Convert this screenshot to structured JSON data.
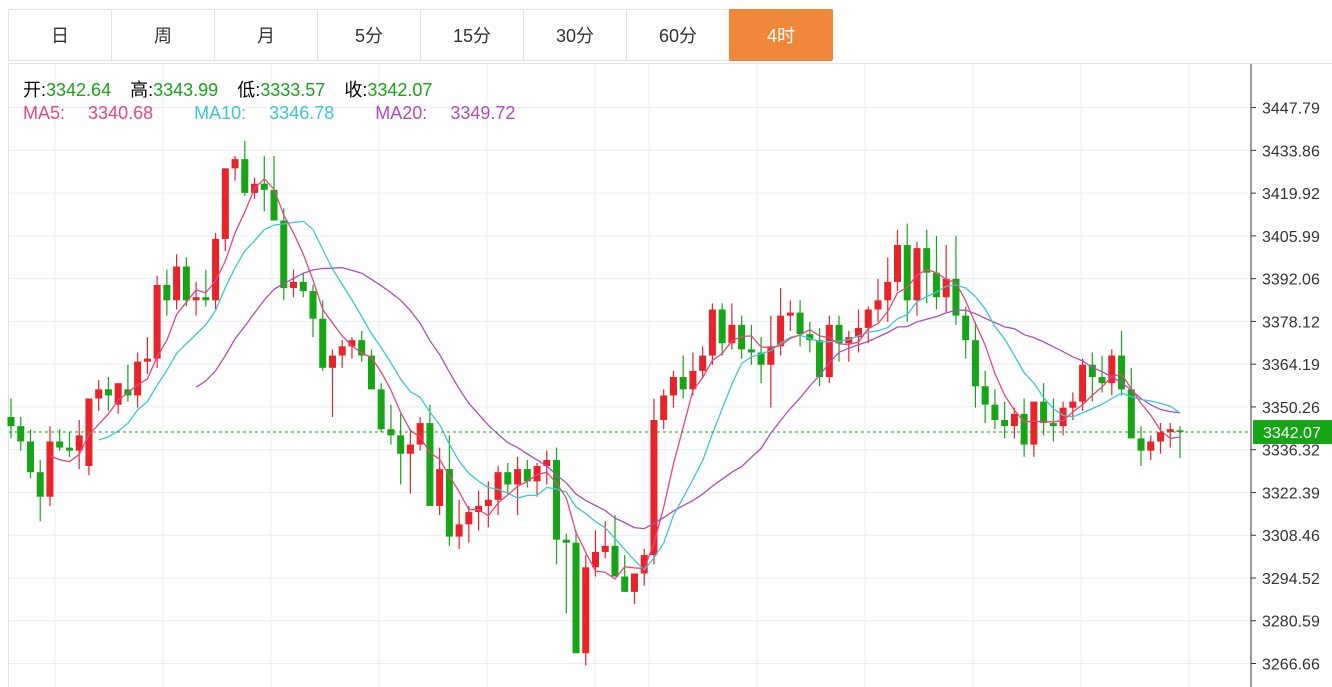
{
  "tabs": [
    {
      "label": "日",
      "active": false
    },
    {
      "label": "周",
      "active": false
    },
    {
      "label": "月",
      "active": false
    },
    {
      "label": "5分",
      "active": false
    },
    {
      "label": "15分",
      "active": false
    },
    {
      "label": "30分",
      "active": false
    },
    {
      "label": "60分",
      "active": false
    },
    {
      "label": "4时",
      "active": true
    }
  ],
  "ohlc": {
    "open_label": "开:",
    "open": "3342.64",
    "high_label": "高:",
    "high": "3343.99",
    "low_label": "低:",
    "low": "3333.57",
    "close_label": "收:",
    "close": "3342.07"
  },
  "ma": {
    "ma5_label": "MA5:",
    "ma5": "3340.68",
    "ma10_label": "MA10:",
    "ma10": "3346.78",
    "ma20_label": "MA20:",
    "ma20": "3349.72"
  },
  "colors": {
    "up": "#e8232a",
    "down": "#16a516",
    "ma5": "#e8477a",
    "ma10": "#3cc8d4",
    "ma20": "#b24bbd",
    "grid": "#e8eef3",
    "active_tab": "#f0883a",
    "current_price": "#16a516"
  },
  "chart_data": {
    "type": "candlestick",
    "ylim": [
      3259,
      3462
    ],
    "y_ticks": [
      "3447.79",
      "3433.86",
      "3419.92",
      "3405.99",
      "3392.06",
      "3378.12",
      "3364.19",
      "3350.26",
      "3336.32",
      "3322.39",
      "3308.46",
      "3294.52",
      "3280.59",
      "3266.66"
    ],
    "current_price": "3342.07",
    "candles": [
      [
        3347,
        3353,
        3340,
        3344
      ],
      [
        3344,
        3347,
        3336,
        3339
      ],
      [
        3339,
        3343,
        3327,
        3329
      ],
      [
        3329,
        3333,
        3313,
        3321
      ],
      [
        3321,
        3344,
        3318,
        3339
      ],
      [
        3339,
        3343,
        3336,
        3337
      ],
      [
        3337,
        3342,
        3334,
        3336
      ],
      [
        3336,
        3346,
        3330,
        3341
      ],
      [
        3331,
        3347,
        3328,
        3353
      ],
      [
        3353,
        3359,
        3349,
        3356
      ],
      [
        3356,
        3360,
        3349,
        3354
      ],
      [
        3351,
        3356,
        3348,
        3358
      ],
      [
        3356,
        3364,
        3352,
        3354
      ],
      [
        3354,
        3368,
        3350,
        3365
      ],
      [
        3365,
        3373,
        3361,
        3366
      ],
      [
        3366,
        3393,
        3363,
        3390
      ],
      [
        3390,
        3395,
        3380,
        3385
      ],
      [
        3385,
        3400,
        3382,
        3396
      ],
      [
        3396,
        3399,
        3383,
        3385
      ],
      [
        3385,
        3391,
        3380,
        3386
      ],
      [
        3386,
        3395,
        3383,
        3385
      ],
      [
        3385,
        3407,
        3382,
        3405
      ],
      [
        3405,
        3428,
        3401,
        3428
      ],
      [
        3428,
        3432,
        3424,
        3431
      ],
      [
        3431,
        3437,
        3419,
        3420
      ],
      [
        3420,
        3425,
        3418,
        3423
      ],
      [
        3423,
        3432,
        3414,
        3421
      ],
      [
        3421,
        3432,
        3417,
        3411
      ],
      [
        3411,
        3415,
        3385,
        3389
      ],
      [
        3389,
        3395,
        3386,
        3391
      ],
      [
        3391,
        3394,
        3386,
        3388
      ],
      [
        3388,
        3390,
        3373,
        3379
      ],
      [
        3379,
        3385,
        3362,
        3363
      ],
      [
        3363,
        3369,
        3347,
        3367
      ],
      [
        3367,
        3372,
        3363,
        3370
      ],
      [
        3370,
        3373,
        3366,
        3372
      ],
      [
        3372,
        3375,
        3365,
        3367
      ],
      [
        3367,
        3369,
        3356,
        3356
      ],
      [
        3356,
        3358,
        3342,
        3343
      ],
      [
        3343,
        3351,
        3338,
        3341
      ],
      [
        3341,
        3348,
        3325,
        3335
      ],
      [
        3335,
        3343,
        3322,
        3338
      ],
      [
        3338,
        3347,
        3336,
        3345
      ],
      [
        3345,
        3351,
        3319,
        3318
      ],
      [
        3318,
        3337,
        3315,
        3330
      ],
      [
        3330,
        3341,
        3305,
        3308
      ],
      [
        3308,
        3320,
        3304,
        3312
      ],
      [
        3312,
        3318,
        3306,
        3316
      ],
      [
        3316,
        3323,
        3310,
        3318
      ],
      [
        3318,
        3326,
        3311,
        3320
      ],
      [
        3320,
        3331,
        3315,
        3329
      ],
      [
        3329,
        3332,
        3322,
        3325
      ],
      [
        3325,
        3334,
        3315,
        3330
      ],
      [
        3330,
        3333,
        3324,
        3326
      ],
      [
        3326,
        3332,
        3321,
        3331
      ],
      [
        3331,
        3336,
        3325,
        3333
      ],
      [
        3333,
        3337,
        3299,
        3307
      ],
      [
        3307,
        3309,
        3283,
        3306
      ],
      [
        3306,
        3310,
        3276,
        3270
      ],
      [
        3270,
        3302,
        3266,
        3298
      ],
      [
        3298,
        3310,
        3295,
        3303
      ],
      [
        3303,
        3313,
        3301,
        3305
      ],
      [
        3305,
        3315,
        3296,
        3295
      ],
      [
        3295,
        3302,
        3290,
        3290
      ],
      [
        3290,
        3296,
        3286,
        3296
      ],
      [
        3296,
        3304,
        3292,
        3302
      ],
      [
        3302,
        3353,
        3299,
        3346
      ],
      [
        3346,
        3356,
        3343,
        3354
      ],
      [
        3354,
        3362,
        3350,
        3360
      ],
      [
        3360,
        3367,
        3353,
        3356
      ],
      [
        3356,
        3368,
        3354,
        3362
      ],
      [
        3362,
        3370,
        3360,
        3367
      ],
      [
        3367,
        3384,
        3364,
        3382
      ],
      [
        3382,
        3384,
        3367,
        3371
      ],
      [
        3371,
        3384,
        3369,
        3377
      ],
      [
        3377,
        3380,
        3366,
        3369
      ],
      [
        3369,
        3377,
        3364,
        3368
      ],
      [
        3368,
        3373,
        3358,
        3364
      ],
      [
        3364,
        3380,
        3350,
        3370
      ],
      [
        3370,
        3389,
        3367,
        3380
      ],
      [
        3380,
        3385,
        3375,
        3381
      ],
      [
        3381,
        3385,
        3370,
        3374
      ],
      [
        3374,
        3378,
        3368,
        3372
      ],
      [
        3372,
        3376,
        3357,
        3360
      ],
      [
        3360,
        3380,
        3358,
        3377
      ],
      [
        3377,
        3380,
        3365,
        3371
      ],
      [
        3371,
        3375,
        3365,
        3373
      ],
      [
        3373,
        3382,
        3368,
        3376
      ],
      [
        3376,
        3383,
        3371,
        3382
      ],
      [
        3382,
        3392,
        3378,
        3385
      ],
      [
        3385,
        3399,
        3378,
        3391
      ],
      [
        3391,
        3408,
        3388,
        3403
      ],
      [
        3403,
        3410,
        3378,
        3385
      ],
      [
        3385,
        3404,
        3380,
        3402
      ],
      [
        3402,
        3408,
        3384,
        3394
      ],
      [
        3394,
        3406,
        3382,
        3386
      ],
      [
        3386,
        3403,
        3381,
        3392
      ],
      [
        3392,
        3406,
        3377,
        3380
      ],
      [
        3380,
        3383,
        3366,
        3372
      ],
      [
        3372,
        3378,
        3350,
        3357
      ],
      [
        3357,
        3362,
        3345,
        3351
      ],
      [
        3351,
        3356,
        3343,
        3346
      ],
      [
        3346,
        3352,
        3340,
        3344
      ],
      [
        3344,
        3350,
        3340,
        3348
      ],
      [
        3348,
        3353,
        3334,
        3338
      ],
      [
        3338,
        3348,
        3334,
        3352
      ],
      [
        3352,
        3358,
        3341,
        3345
      ],
      [
        3345,
        3353,
        3339,
        3344
      ],
      [
        3344,
        3352,
        3341,
        3350
      ],
      [
        3350,
        3355,
        3346,
        3352
      ],
      [
        3352,
        3366,
        3349,
        3364
      ],
      [
        3364,
        3368,
        3352,
        3360
      ],
      [
        3360,
        3367,
        3355,
        3358
      ],
      [
        3358,
        3369,
        3354,
        3367
      ],
      [
        3367,
        3375,
        3354,
        3356
      ],
      [
        3356,
        3363,
        3343,
        3340
      ],
      [
        3340,
        3344,
        3331,
        3336
      ],
      [
        3336,
        3341,
        3333,
        3339
      ],
      [
        3339,
        3345,
        3335,
        3342
      ],
      [
        3342,
        3345,
        3337,
        3343
      ],
      [
        3342.64,
        3343.99,
        3333.57,
        3342.07
      ]
    ],
    "ma5_last": 3340.68,
    "ma10_last": 3346.78,
    "ma20_last": 3349.72
  }
}
